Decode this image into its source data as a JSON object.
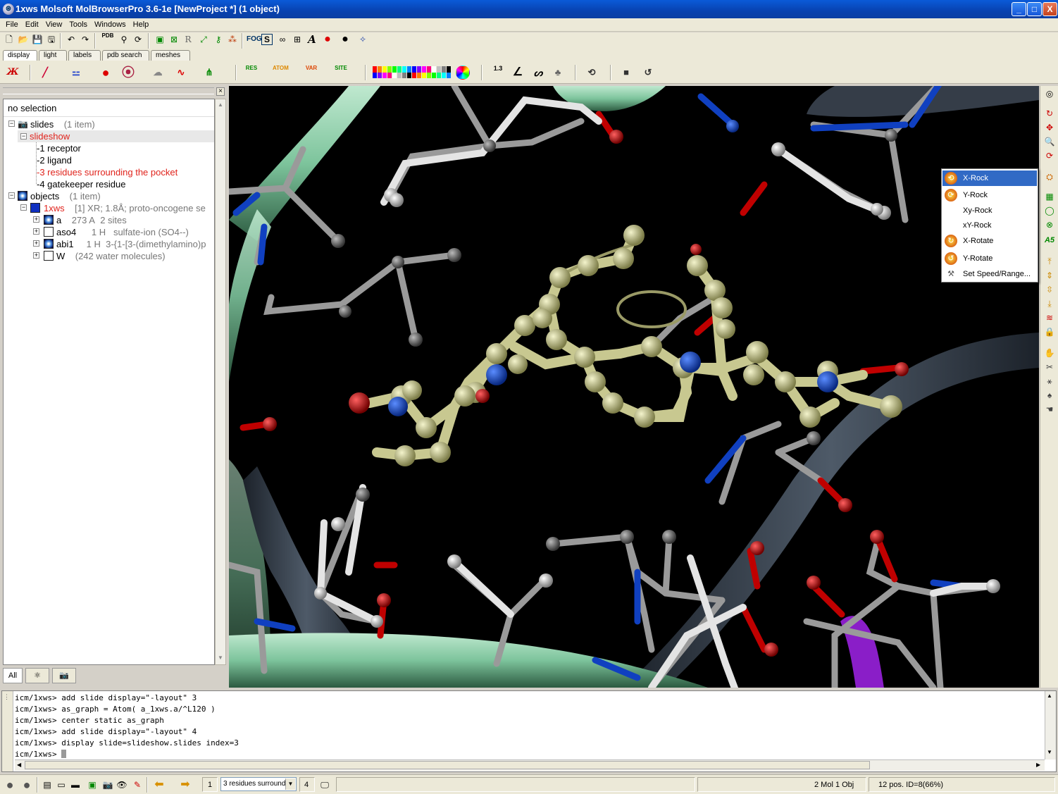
{
  "window": {
    "title": "1xws Molsoft MolBrowserPro 3.6-1e  [NewProject *] (1 object)",
    "minimize": "_",
    "maximize": "□",
    "close": "X"
  },
  "menu": {
    "items": [
      "File",
      "Edit",
      "View",
      "Tools",
      "Windows",
      "Help"
    ]
  },
  "tabs": [
    "display",
    "light",
    "labels",
    "pdb search",
    "meshes"
  ],
  "toolbar": {
    "pdb_label": "PDB",
    "r_label": "R",
    "fog_label": "FOG",
    "s_label": "S",
    "res_label": "RES",
    "atom_label": "ATOM",
    "var_label": "VAR",
    "site_label": "SITE",
    "measure_label": "1.3"
  },
  "left_panel": {
    "selection_status": "no selection",
    "tree": {
      "slides": {
        "label": "slides",
        "count": "(1 item)"
      },
      "slideshow": {
        "label": "slideshow"
      },
      "slide_items": [
        "1 receptor",
        "2 ligand",
        "3 residues surrounding the pocket",
        "4 gatekeeper residue"
      ],
      "objects": {
        "label": "objects",
        "count": "(1 item)"
      },
      "object_1xws": {
        "label": "1xws",
        "detail": "[1] XR; 1.8Å; proto-oncogene se"
      },
      "molecules": [
        {
          "name": "a",
          "size": "273 A",
          "desc": "2 sites"
        },
        {
          "name": "aso4",
          "size": "1 H",
          "desc": "sulfate-ion (SO4--)"
        },
        {
          "name": "abi1",
          "size": "1 H",
          "desc": "3-{1-[3-(dimethylamino)p"
        },
        {
          "name": "W",
          "size": "",
          "desc": "(242 water molecules)"
        }
      ]
    },
    "bottom_tabs": {
      "all": "All"
    }
  },
  "context_menu": {
    "items": [
      "X-Rock",
      "Y-Rock",
      "Xy-Rock",
      "xY-Rock",
      "X-Rotate",
      "Y-Rotate",
      "Set Speed/Range..."
    ]
  },
  "right_toolbar": {
    "a5_label": "A5"
  },
  "console": {
    "lines": [
      "icm/1xws> add slide display=\"-layout\" 3",
      "icm/1xws> as_graph = Atom( a_1xws.a/^L120 )",
      "icm/1xws> center static as_graph",
      "icm/1xws> add slide display=\"-layout\" 4",
      "icm/1xws> display slide=slideshow.slides index=3",
      "icm/1xws> "
    ]
  },
  "status": {
    "slide_index": "1",
    "slide_dropdown": "3 residues surroundi",
    "slide_total": "4",
    "mol_obj": "2 Mol 1 Obj",
    "pos_info": "12 pos. ID=8(66%)"
  },
  "colors": {
    "title_bar": "#0842b0",
    "menu_highlight": "#316ac5",
    "ligand": "#c8c890",
    "ribbon_green": "#7dc49c",
    "ribbon_gray": "#3c4654",
    "oxygen": "#d00000",
    "nitrogen": "#1040c0",
    "palette": [
      "#ff0000",
      "#ff8000",
      "#ffff00",
      "#80ff00",
      "#00ff00",
      "#00ff80",
      "#00ffff",
      "#0080ff",
      "#0000ff",
      "#8000ff",
      "#ff00ff",
      "#ff0080",
      "#ffffff",
      "#c0c0c0",
      "#808080",
      "#000000"
    ]
  },
  "icons": {
    "toolbar1": [
      "new-file-icon",
      "open-folder-icon",
      "save-icon",
      "save-all-icon",
      "undo-icon",
      "redo-icon",
      "pdb-icon",
      "find-icon",
      "refresh-icon",
      "select-icon",
      "stop-select-icon",
      "r-icon",
      "expand-icon",
      "key-icon",
      "tree-icon",
      "fog-icon",
      "s-icon",
      "glasses-icon",
      "grid-icon",
      "text-a-icon",
      "color-ball-icon",
      "black-ball-icon",
      "magic-icon"
    ]
  }
}
